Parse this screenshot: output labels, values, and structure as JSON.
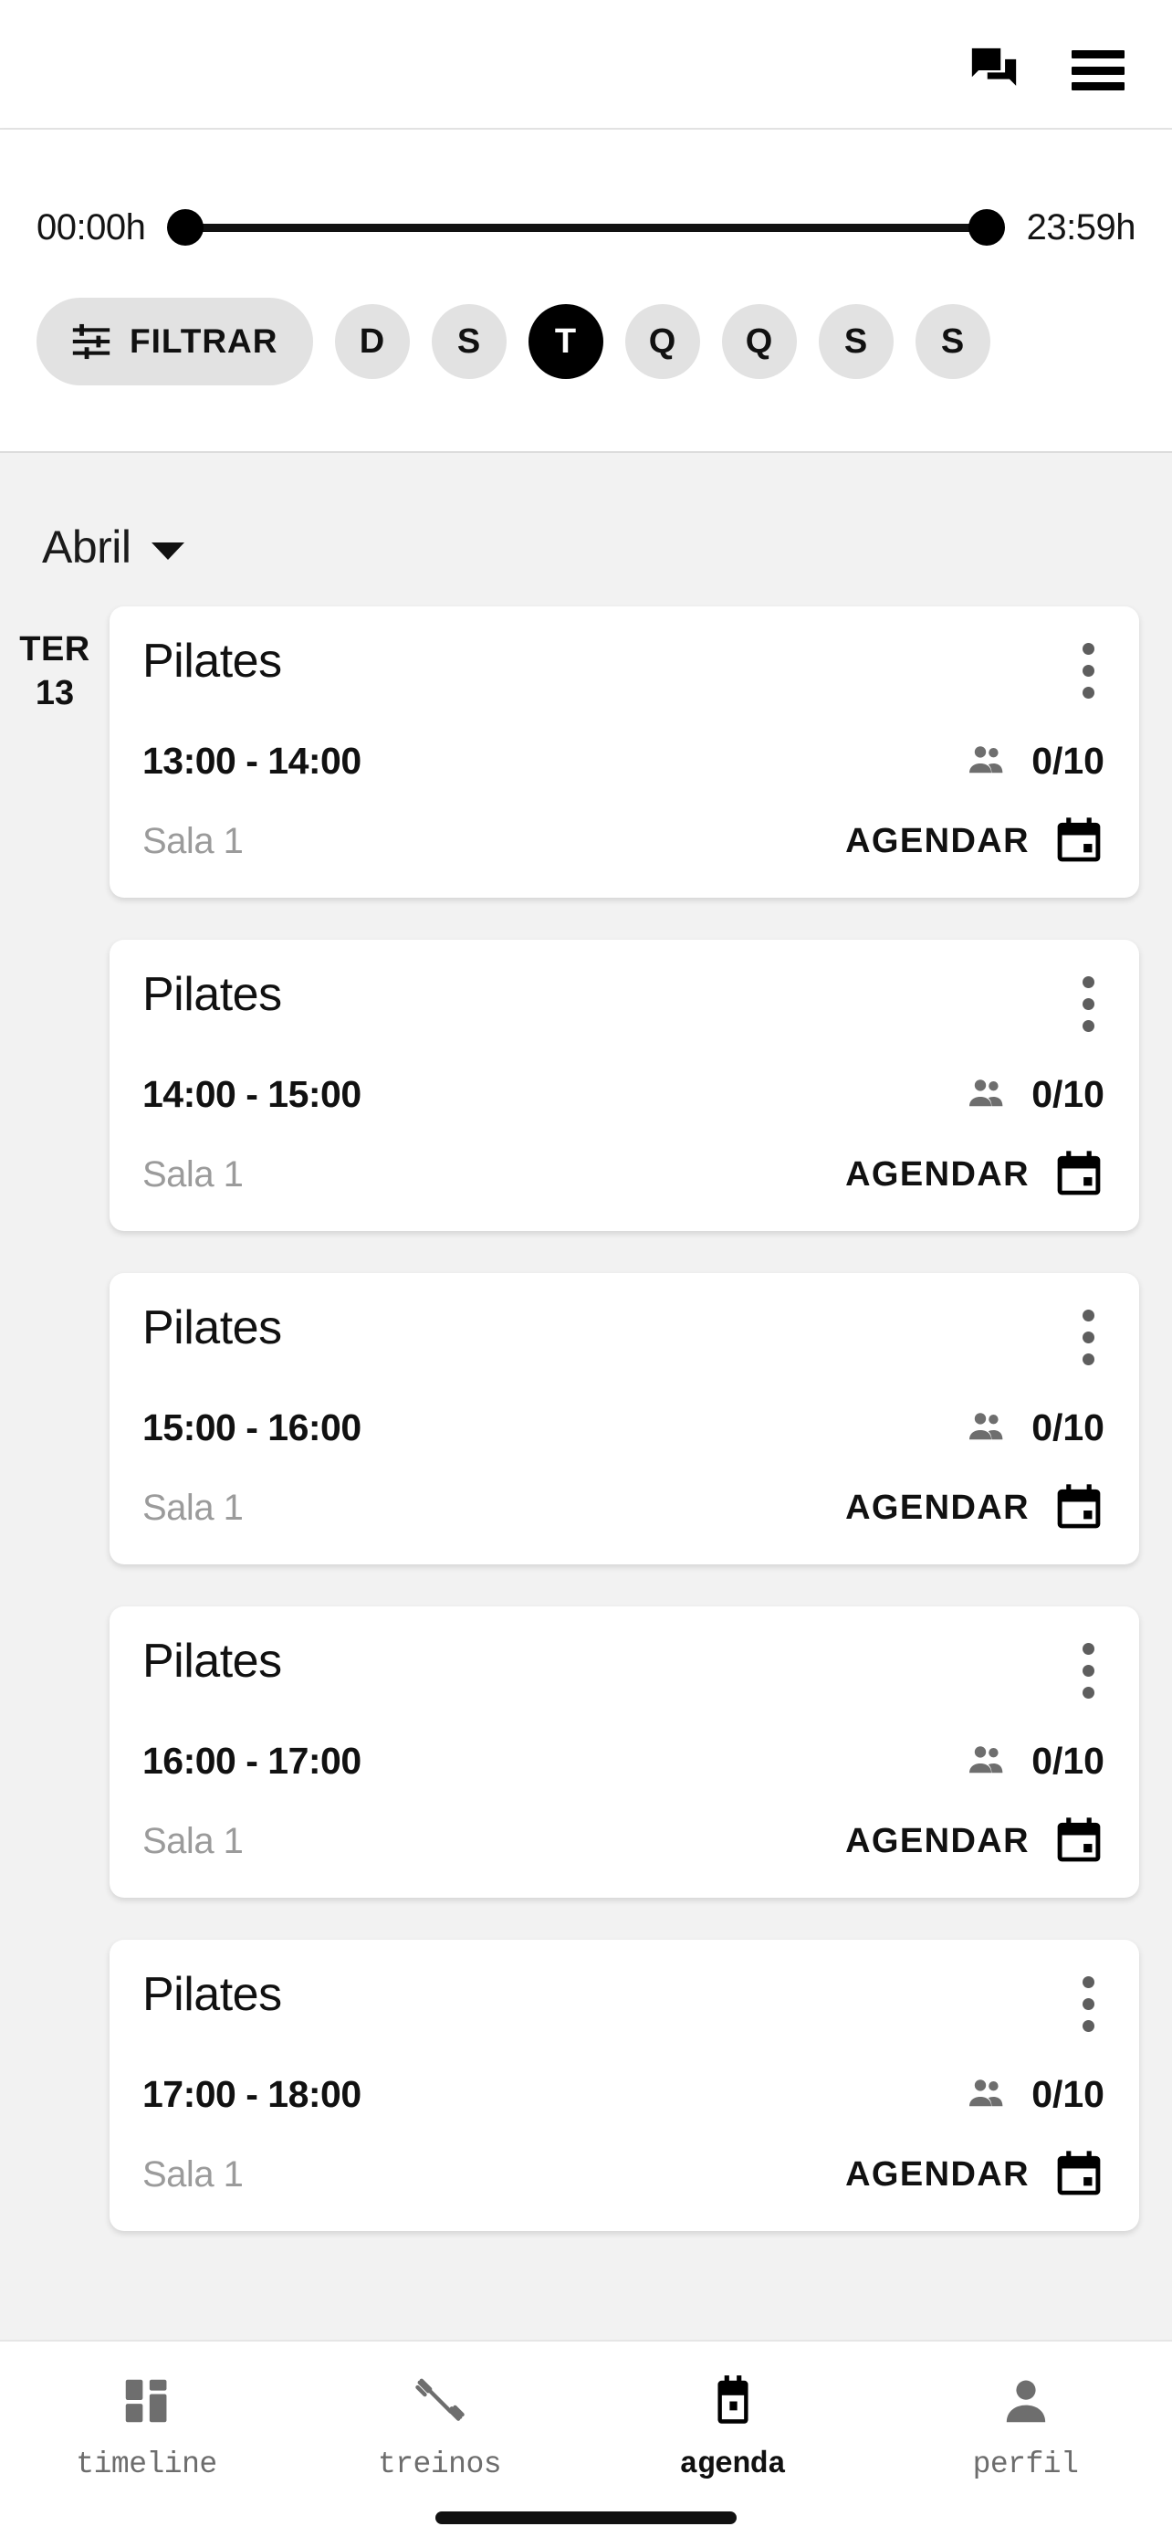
{
  "appbar": {
    "chat_icon": "question-answer-icon",
    "menu_icon": "hamburger-menu-icon"
  },
  "filter_panel": {
    "time_range": {
      "start_label": "00:00h",
      "end_label": "23:59h",
      "start_value": "00:00",
      "end_value": "23:59"
    },
    "filter_button": {
      "label": "FILTRAR",
      "icon": "tune-icon"
    },
    "day_chips": [
      {
        "label": "D",
        "active": false
      },
      {
        "label": "S",
        "active": false
      },
      {
        "label": "T",
        "active": true
      },
      {
        "label": "Q",
        "active": false
      },
      {
        "label": "Q",
        "active": false
      },
      {
        "label": "S",
        "active": false
      },
      {
        "label": "S",
        "active": false
      }
    ]
  },
  "month_selector": {
    "label": "Abril",
    "caret": "chevron-down-icon"
  },
  "schedule": {
    "day": {
      "dow": "TER",
      "num": "13"
    },
    "classes": [
      {
        "title": "Pilates",
        "time": "13:00 - 14:00",
        "room": "Sala 1",
        "capacity": "0/10",
        "action_label": "AGENDAR"
      },
      {
        "title": "Pilates",
        "time": "14:00 - 15:00",
        "room": "Sala 1",
        "capacity": "0/10",
        "action_label": "AGENDAR"
      },
      {
        "title": "Pilates",
        "time": "15:00 - 16:00",
        "room": "Sala 1",
        "capacity": "0/10",
        "action_label": "AGENDAR"
      },
      {
        "title": "Pilates",
        "time": "16:00 - 17:00",
        "room": "Sala 1",
        "capacity": "0/10",
        "action_label": "AGENDAR"
      },
      {
        "title": "Pilates",
        "time": "17:00 - 18:00",
        "room": "Sala 1",
        "capacity": "0/10",
        "action_label": "AGENDAR"
      }
    ]
  },
  "bottom_nav": {
    "items": [
      {
        "label": "timeline",
        "icon": "dashboard-grid-icon",
        "active": false
      },
      {
        "label": "treinos",
        "icon": "dumbbell-icon",
        "active": false
      },
      {
        "label": "agenda",
        "icon": "calendar-icon",
        "active": true
      },
      {
        "label": "perfil",
        "icon": "person-icon",
        "active": false
      }
    ]
  },
  "colors": {
    "accent": "#000000",
    "chip_bg": "#e2e2e2",
    "page_bg": "#f2f2f2",
    "card_bg": "#ffffff",
    "muted_text": "#9b9b9b",
    "nav_inactive": "#6d6d6d"
  }
}
